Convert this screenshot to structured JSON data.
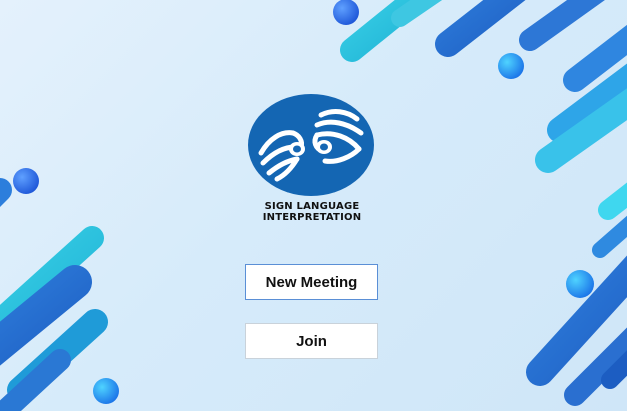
{
  "logo": {
    "line1": "SIGN LANGUAGE",
    "line2": "INTERPRETATION",
    "icon": "sign-language-hands-icon"
  },
  "actions": {
    "new_meeting_label": "New Meeting",
    "join_label": "Join"
  },
  "colors": {
    "background": "#d6ebfa",
    "logo_blue": "#1466b3",
    "accent_blue": "#3b82d6",
    "accent_cyan": "#2ec6e0",
    "button_bg": "#ffffff",
    "primary_button_border": "#5a8fd6"
  }
}
